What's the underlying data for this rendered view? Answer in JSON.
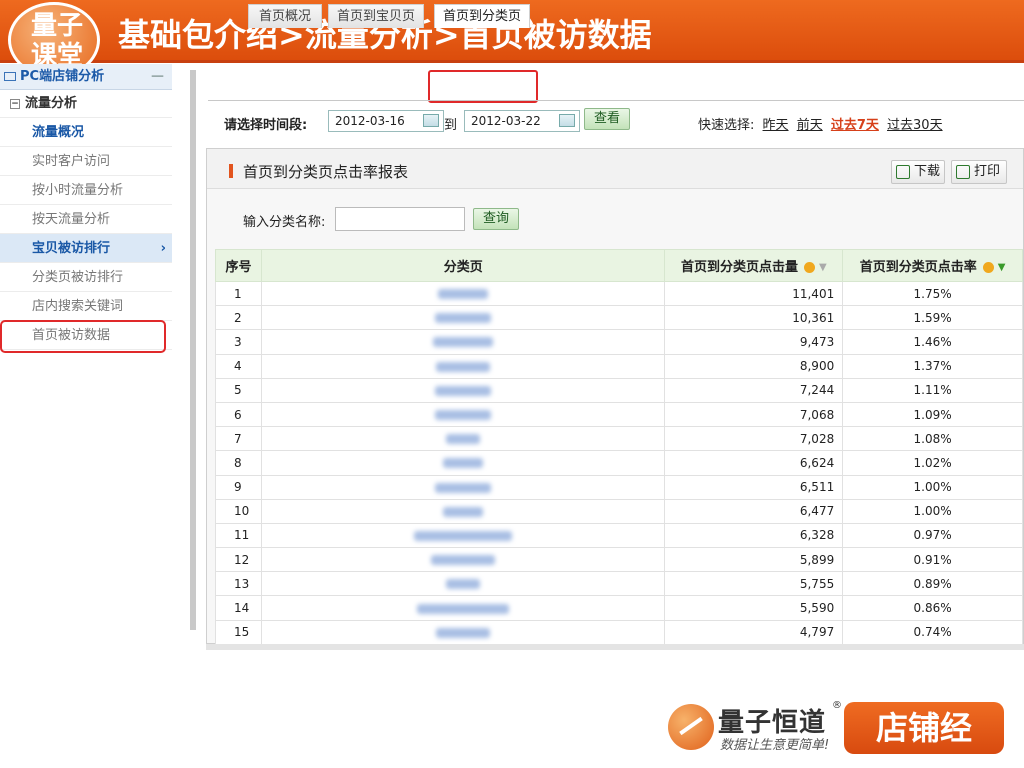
{
  "header": {
    "title": "基础包介绍>流量分析>首页被访数据",
    "logo_text": "量子课堂"
  },
  "sidebar": {
    "head": "PC端店铺分析",
    "section": "流量分析",
    "items": [
      {
        "label": "流量概况"
      },
      {
        "label": "实时客户访问"
      },
      {
        "label": "按小时流量分析"
      },
      {
        "label": "按天流量分析"
      },
      {
        "label": "宝贝被访排行"
      },
      {
        "label": "分类页被访排行"
      },
      {
        "label": "店内搜索关键词"
      },
      {
        "label": "首页被访数据"
      }
    ]
  },
  "tabs": [
    {
      "label": "首页概况"
    },
    {
      "label": "首页到宝贝页"
    },
    {
      "label": "首页到分类页"
    }
  ],
  "datebar": {
    "label": "请选择时间段:",
    "start": "2012-03-16",
    "to": "到",
    "end": "2012-03-22",
    "view_btn": "查看",
    "quick_label": "快速选择:",
    "quick": [
      "昨天",
      "前天",
      "过去7天",
      "过去30天"
    ]
  },
  "report": {
    "title": "首页到分类页点击率报表",
    "download": "下载",
    "print": "打印",
    "search_label": "输入分类名称:",
    "search_btn": "查询",
    "columns": [
      "序号",
      "分类页",
      "首页到分类页点击量",
      "首页到分类页点击率"
    ],
    "rows": [
      {
        "no": "1",
        "clicks": "11,401",
        "rate": "1.75%",
        "w": 50
      },
      {
        "no": "2",
        "clicks": "10,361",
        "rate": "1.59%",
        "w": 56
      },
      {
        "no": "3",
        "clicks": "9,473",
        "rate": "1.46%",
        "w": 60
      },
      {
        "no": "4",
        "clicks": "8,900",
        "rate": "1.37%",
        "w": 54
      },
      {
        "no": "5",
        "clicks": "7,244",
        "rate": "1.11%",
        "w": 56
      },
      {
        "no": "6",
        "clicks": "7,068",
        "rate": "1.09%",
        "w": 56
      },
      {
        "no": "7",
        "clicks": "7,028",
        "rate": "1.08%",
        "w": 34
      },
      {
        "no": "8",
        "clicks": "6,624",
        "rate": "1.02%",
        "w": 40
      },
      {
        "no": "9",
        "clicks": "6,511",
        "rate": "1.00%",
        "w": 56
      },
      {
        "no": "10",
        "clicks": "6,477",
        "rate": "1.00%",
        "w": 40
      },
      {
        "no": "11",
        "clicks": "6,328",
        "rate": "0.97%",
        "w": 98
      },
      {
        "no": "12",
        "clicks": "5,899",
        "rate": "0.91%",
        "w": 64
      },
      {
        "no": "13",
        "clicks": "5,755",
        "rate": "0.89%",
        "w": 34
      },
      {
        "no": "14",
        "clicks": "5,590",
        "rate": "0.86%",
        "w": 92
      },
      {
        "no": "15",
        "clicks": "4,797",
        "rate": "0.74%",
        "w": 54
      }
    ]
  },
  "brand": {
    "name": "量子恒道",
    "reg": "®",
    "slogan": "数据让生意更简单!",
    "shop": "店铺经"
  }
}
